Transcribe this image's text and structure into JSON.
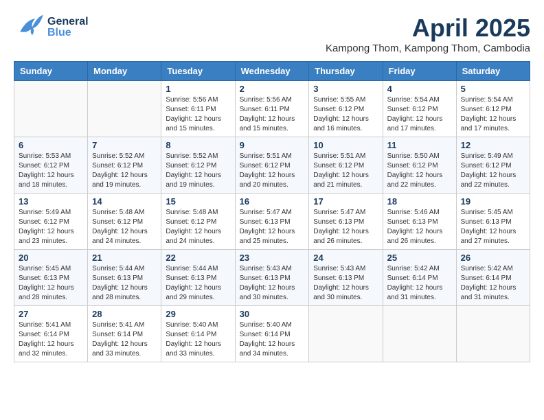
{
  "header": {
    "logo_general": "General",
    "logo_blue": "Blue",
    "month_title": "April 2025",
    "subtitle": "Kampong Thom, Kampong Thom, Cambodia"
  },
  "days_of_week": [
    "Sunday",
    "Monday",
    "Tuesday",
    "Wednesday",
    "Thursday",
    "Friday",
    "Saturday"
  ],
  "weeks": [
    [
      {
        "day": "",
        "sunrise": "",
        "sunset": "",
        "daylight": ""
      },
      {
        "day": "",
        "sunrise": "",
        "sunset": "",
        "daylight": ""
      },
      {
        "day": "1",
        "sunrise": "Sunrise: 5:56 AM",
        "sunset": "Sunset: 6:11 PM",
        "daylight": "Daylight: 12 hours and 15 minutes."
      },
      {
        "day": "2",
        "sunrise": "Sunrise: 5:56 AM",
        "sunset": "Sunset: 6:11 PM",
        "daylight": "Daylight: 12 hours and 15 minutes."
      },
      {
        "day": "3",
        "sunrise": "Sunrise: 5:55 AM",
        "sunset": "Sunset: 6:12 PM",
        "daylight": "Daylight: 12 hours and 16 minutes."
      },
      {
        "day": "4",
        "sunrise": "Sunrise: 5:54 AM",
        "sunset": "Sunset: 6:12 PM",
        "daylight": "Daylight: 12 hours and 17 minutes."
      },
      {
        "day": "5",
        "sunrise": "Sunrise: 5:54 AM",
        "sunset": "Sunset: 6:12 PM",
        "daylight": "Daylight: 12 hours and 17 minutes."
      }
    ],
    [
      {
        "day": "6",
        "sunrise": "Sunrise: 5:53 AM",
        "sunset": "Sunset: 6:12 PM",
        "daylight": "Daylight: 12 hours and 18 minutes."
      },
      {
        "day": "7",
        "sunrise": "Sunrise: 5:52 AM",
        "sunset": "Sunset: 6:12 PM",
        "daylight": "Daylight: 12 hours and 19 minutes."
      },
      {
        "day": "8",
        "sunrise": "Sunrise: 5:52 AM",
        "sunset": "Sunset: 6:12 PM",
        "daylight": "Daylight: 12 hours and 19 minutes."
      },
      {
        "day": "9",
        "sunrise": "Sunrise: 5:51 AM",
        "sunset": "Sunset: 6:12 PM",
        "daylight": "Daylight: 12 hours and 20 minutes."
      },
      {
        "day": "10",
        "sunrise": "Sunrise: 5:51 AM",
        "sunset": "Sunset: 6:12 PM",
        "daylight": "Daylight: 12 hours and 21 minutes."
      },
      {
        "day": "11",
        "sunrise": "Sunrise: 5:50 AM",
        "sunset": "Sunset: 6:12 PM",
        "daylight": "Daylight: 12 hours and 22 minutes."
      },
      {
        "day": "12",
        "sunrise": "Sunrise: 5:49 AM",
        "sunset": "Sunset: 6:12 PM",
        "daylight": "Daylight: 12 hours and 22 minutes."
      }
    ],
    [
      {
        "day": "13",
        "sunrise": "Sunrise: 5:49 AM",
        "sunset": "Sunset: 6:12 PM",
        "daylight": "Daylight: 12 hours and 23 minutes."
      },
      {
        "day": "14",
        "sunrise": "Sunrise: 5:48 AM",
        "sunset": "Sunset: 6:12 PM",
        "daylight": "Daylight: 12 hours and 24 minutes."
      },
      {
        "day": "15",
        "sunrise": "Sunrise: 5:48 AM",
        "sunset": "Sunset: 6:12 PM",
        "daylight": "Daylight: 12 hours and 24 minutes."
      },
      {
        "day": "16",
        "sunrise": "Sunrise: 5:47 AM",
        "sunset": "Sunset: 6:13 PM",
        "daylight": "Daylight: 12 hours and 25 minutes."
      },
      {
        "day": "17",
        "sunrise": "Sunrise: 5:47 AM",
        "sunset": "Sunset: 6:13 PM",
        "daylight": "Daylight: 12 hours and 26 minutes."
      },
      {
        "day": "18",
        "sunrise": "Sunrise: 5:46 AM",
        "sunset": "Sunset: 6:13 PM",
        "daylight": "Daylight: 12 hours and 26 minutes."
      },
      {
        "day": "19",
        "sunrise": "Sunrise: 5:45 AM",
        "sunset": "Sunset: 6:13 PM",
        "daylight": "Daylight: 12 hours and 27 minutes."
      }
    ],
    [
      {
        "day": "20",
        "sunrise": "Sunrise: 5:45 AM",
        "sunset": "Sunset: 6:13 PM",
        "daylight": "Daylight: 12 hours and 28 minutes."
      },
      {
        "day": "21",
        "sunrise": "Sunrise: 5:44 AM",
        "sunset": "Sunset: 6:13 PM",
        "daylight": "Daylight: 12 hours and 28 minutes."
      },
      {
        "day": "22",
        "sunrise": "Sunrise: 5:44 AM",
        "sunset": "Sunset: 6:13 PM",
        "daylight": "Daylight: 12 hours and 29 minutes."
      },
      {
        "day": "23",
        "sunrise": "Sunrise: 5:43 AM",
        "sunset": "Sunset: 6:13 PM",
        "daylight": "Daylight: 12 hours and 30 minutes."
      },
      {
        "day": "24",
        "sunrise": "Sunrise: 5:43 AM",
        "sunset": "Sunset: 6:13 PM",
        "daylight": "Daylight: 12 hours and 30 minutes."
      },
      {
        "day": "25",
        "sunrise": "Sunrise: 5:42 AM",
        "sunset": "Sunset: 6:14 PM",
        "daylight": "Daylight: 12 hours and 31 minutes."
      },
      {
        "day": "26",
        "sunrise": "Sunrise: 5:42 AM",
        "sunset": "Sunset: 6:14 PM",
        "daylight": "Daylight: 12 hours and 31 minutes."
      }
    ],
    [
      {
        "day": "27",
        "sunrise": "Sunrise: 5:41 AM",
        "sunset": "Sunset: 6:14 PM",
        "daylight": "Daylight: 12 hours and 32 minutes."
      },
      {
        "day": "28",
        "sunrise": "Sunrise: 5:41 AM",
        "sunset": "Sunset: 6:14 PM",
        "daylight": "Daylight: 12 hours and 33 minutes."
      },
      {
        "day": "29",
        "sunrise": "Sunrise: 5:40 AM",
        "sunset": "Sunset: 6:14 PM",
        "daylight": "Daylight: 12 hours and 33 minutes."
      },
      {
        "day": "30",
        "sunrise": "Sunrise: 5:40 AM",
        "sunset": "Sunset: 6:14 PM",
        "daylight": "Daylight: 12 hours and 34 minutes."
      },
      {
        "day": "",
        "sunrise": "",
        "sunset": "",
        "daylight": ""
      },
      {
        "day": "",
        "sunrise": "",
        "sunset": "",
        "daylight": ""
      },
      {
        "day": "",
        "sunrise": "",
        "sunset": "",
        "daylight": ""
      }
    ]
  ]
}
